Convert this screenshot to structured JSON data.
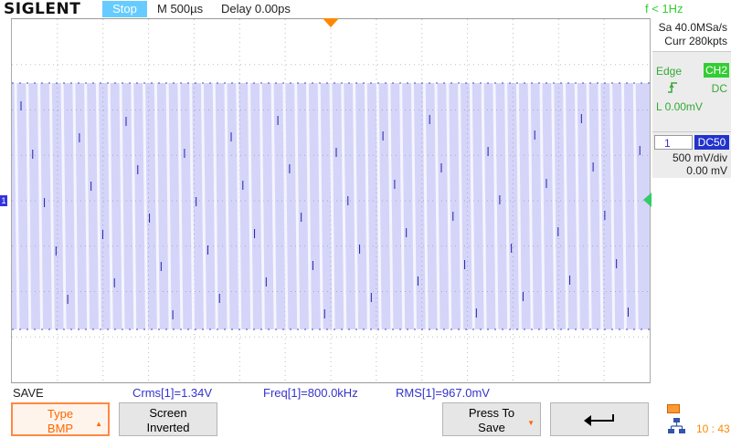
{
  "brand": "SIGLENT",
  "top": {
    "run_state": "Stop",
    "timebase": "M 500µs",
    "delay": "Delay 0.00ps",
    "freq_counter": "f < 1Hz"
  },
  "acquisition": {
    "sample_rate": "Sa 40.0MSa/s",
    "memory": "Curr 280kpts"
  },
  "trigger": {
    "type": "Edge",
    "source": "CH2",
    "coupling": "DC",
    "level": "L  0.00mV",
    "slope_icon": "rising-edge-icon",
    "color": "#33cc33"
  },
  "channel": {
    "number": "1",
    "coupling": "DC50",
    "vdiv": "500 mV/div",
    "offset": "0.00 mV",
    "marker": "1",
    "color": "#3333cc"
  },
  "bottom": {
    "menu_title": "SAVE",
    "measurements": [
      {
        "label": "Crms[1]=1.34V"
      },
      {
        "label": "Freq[1]=800.0kHz"
      },
      {
        "label": "RMS[1]=967.0mV"
      }
    ],
    "softkeys": {
      "type_label": "Type",
      "type_value": "BMP",
      "screen_label": "Screen",
      "screen_value": "Inverted",
      "press_label": "Press To",
      "press_value": "Save",
      "back_icon": "back-arrow-icon"
    },
    "clock": "10 : 43"
  },
  "colors": {
    "accent": "#ff8800",
    "run_state_bg": "#66ccff",
    "waveform": "#8888ee"
  }
}
